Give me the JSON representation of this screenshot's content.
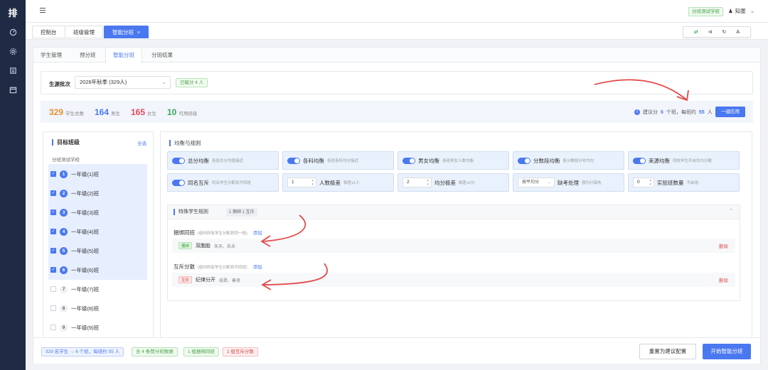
{
  "app": {
    "logo": "排"
  },
  "topbar": {
    "school_tag": "分班测试学校",
    "user": "知墨"
  },
  "tabs": [
    {
      "label": "控制台"
    },
    {
      "label": "班级管理"
    },
    {
      "label": "智能分班",
      "close": "×"
    }
  ],
  "tools": [
    "⇄",
    "⊲",
    "↻",
    "A"
  ],
  "subtabs": [
    "学生管理",
    "预分班",
    "智能分班",
    "分班结果"
  ],
  "batch": {
    "label": "生源批次",
    "value": "2026年秋季 (329人)",
    "tag": "已赋分 4 人"
  },
  "stats": [
    {
      "value": "329",
      "label": "学生总数",
      "color": "#e8912d"
    },
    {
      "value": "164",
      "label": "男生",
      "color": "#4a78f0"
    },
    {
      "value": "165",
      "label": "女生",
      "color": "#e04a5a"
    },
    {
      "value": "10",
      "label": "可用班级",
      "color": "#3aa85a"
    }
  ],
  "suggest": {
    "prefix": "建议分",
    "classes": "6",
    "mid": "个班，每班约",
    "size": "55",
    "suffix": "人",
    "apply": "一键应用"
  },
  "left": {
    "title": "目标班级",
    "select_all": "全选",
    "school": "分班测试学校",
    "classes": [
      {
        "n": "1",
        "name": "一年级(1)班",
        "checked": true
      },
      {
        "n": "2",
        "name": "一年级(2)班",
        "checked": true
      },
      {
        "n": "3",
        "name": "一年级(3)班",
        "checked": true
      },
      {
        "n": "4",
        "name": "一年级(4)班",
        "checked": true
      },
      {
        "n": "5",
        "name": "一年级(5)班",
        "checked": true
      },
      {
        "n": "6",
        "name": "一年级(6)班",
        "checked": true
      },
      {
        "n": "7",
        "name": "一年级(7)班",
        "checked": false
      },
      {
        "n": "8",
        "name": "一年级(8)班",
        "checked": false
      },
      {
        "n": "9",
        "name": "一年级(9)班",
        "checked": false
      }
    ]
  },
  "rules": {
    "title": "均衡与规则",
    "row1": [
      {
        "name": "总分均衡",
        "desc": "各班总分均值接近"
      },
      {
        "name": "各科均衡",
        "desc": "各班各科均分接近"
      },
      {
        "name": "男女均衡",
        "desc": "各班男女人数均衡"
      },
      {
        "name": "分数段均衡",
        "desc": "各分数段分布均匀"
      },
      {
        "name": "来源均衡",
        "desc": "同校学生开启均匀分散"
      }
    ],
    "row2": {
      "same_name": {
        "name": "同名互斥",
        "desc": "同名学生分配到不同班"
      },
      "headcount": {
        "value": "1",
        "name": "人数极差",
        "desc": "相差≤1人"
      },
      "avg_range": {
        "value": "2",
        "name": "均分极差",
        "desc": "相差≤2分"
      },
      "absent": {
        "value": "按平均分",
        "name": "缺考处理",
        "desc": "按均分填充"
      },
      "experimental": {
        "value": "0",
        "name": "实验班数量",
        "desc": "不启用"
      }
    }
  },
  "special": {
    "title": "特殊学生规则",
    "count": "1 捆绑 1 互斥",
    "collapse": "⌃",
    "bind": {
      "title": "捆绑同班",
      "note": "(组内所有学生分配到同一班)",
      "add": "添加",
      "tag": "捆绑",
      "group": "双胞胎",
      "members": "朱天、朱未",
      "delete": "删除"
    },
    "exclusive": {
      "title": "互斥分散",
      "note": "(组内所有学生分配到不同班)",
      "add": "添加",
      "tag": "互斥",
      "group": "纪律分开",
      "members": "戚柔、秦贤",
      "delete": "删除"
    }
  },
  "footer": {
    "chips": [
      "329 名学生 → 6 个班，每班约 55 人",
      "含 4 条赞分班数据",
      "1 组捆绑同班",
      "1 组互斥分散"
    ],
    "reset": "重置为建议配置",
    "start": "开始智能分班"
  }
}
